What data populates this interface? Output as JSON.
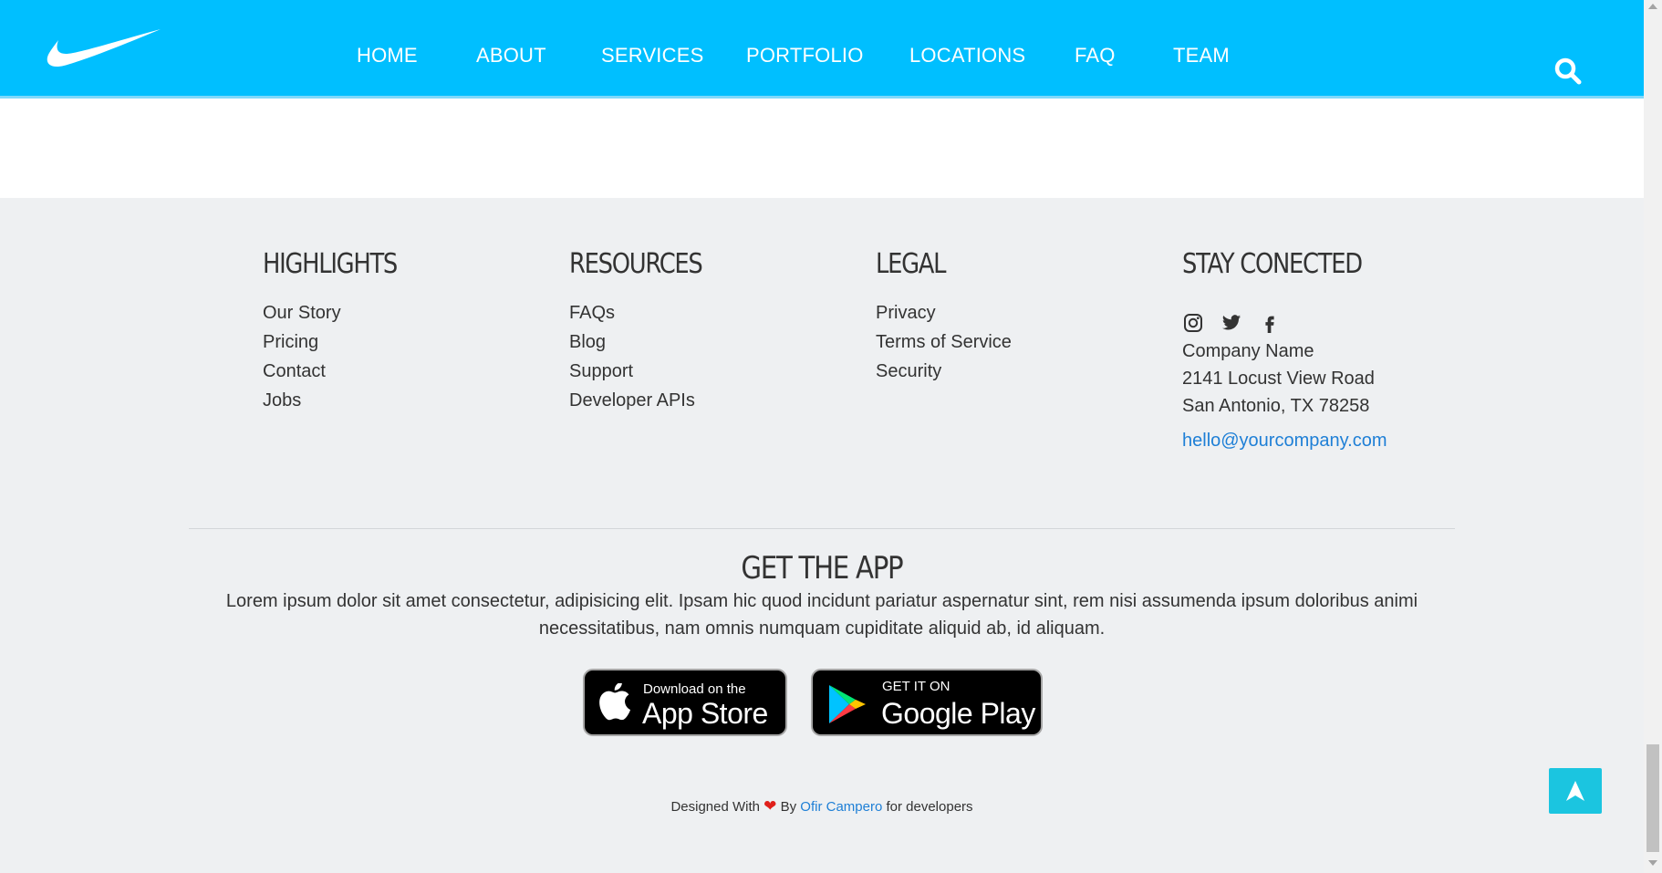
{
  "header": {
    "logo_icon": "swoosh-logo-icon",
    "nav": [
      "HOME",
      "ABOUT",
      "SERVICES",
      "PORTFOLIO",
      "LOCATIONS",
      "FAQ",
      "TEAM"
    ],
    "search_icon": "search-icon",
    "background_color": "#00bfff"
  },
  "footer": {
    "highlights": {
      "title": "HIGHLIGHTS",
      "links": [
        "Our Story",
        "Pricing",
        "Contact",
        "Jobs"
      ]
    },
    "resources": {
      "title": "RESOURCES",
      "links": [
        "FAQs",
        "Blog",
        "Support",
        "Developer APIs"
      ]
    },
    "legal": {
      "title": "LEGAL",
      "links": [
        "Privacy",
        "Terms of Service",
        "Security"
      ]
    },
    "connect": {
      "title": "STAY CONECTED",
      "social_icons": [
        "instagram-icon",
        "twitter-icon",
        "facebook-icon"
      ],
      "company": "Company Name",
      "address_line1": "2141 Locust View Road",
      "address_line2": "San Antonio, TX 78258",
      "email": "hello@yourcompany.com"
    }
  },
  "app": {
    "title": "GET THE APP",
    "description": "Lorem ipsum dolor sit amet consectetur, adipisicing elit. Ipsam hic quod incidunt pariatur aspernatur sint, rem nisi assumenda ipsum doloribus animi necessitatibus, nam omnis numquam cupiditate aliquid ab, id aliquam.",
    "app_store": {
      "small": "Download on the",
      "big": "App Store"
    },
    "google_play": {
      "small": "GET IT ON",
      "big": "Google Play"
    }
  },
  "credit": {
    "prefix": "Designed With",
    "by": "By",
    "author": "Ofir Campero",
    "suffix": "for developers",
    "heart_color": "#e0201b"
  },
  "back_to_top_color": "#1bc5e0",
  "accent_link_color": "#1e7fd6"
}
